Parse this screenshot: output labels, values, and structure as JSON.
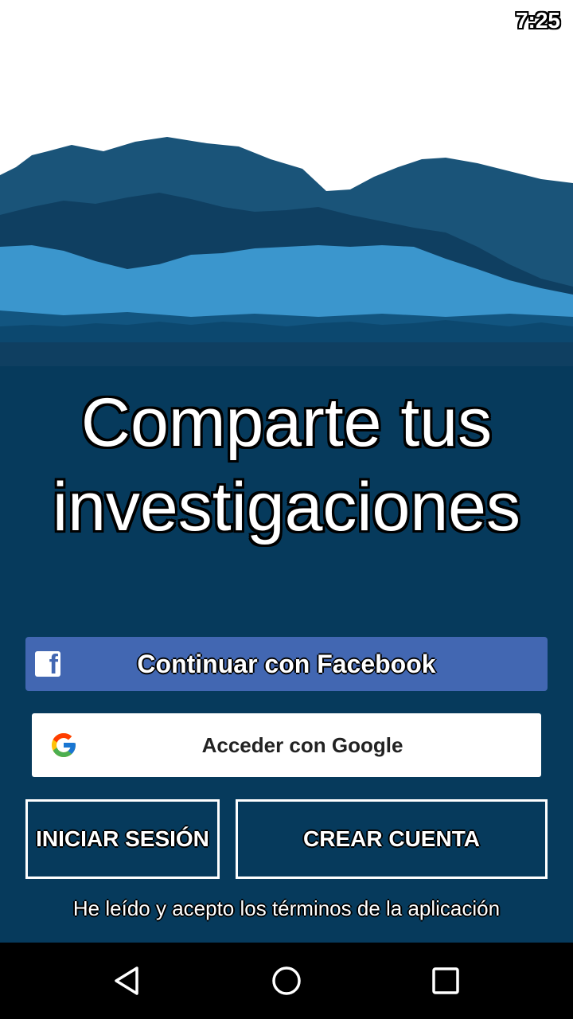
{
  "status_bar": {
    "time": "7:25"
  },
  "hero": {
    "headline_line1": "Comparte tus",
    "headline_line2": "investigaciones",
    "colors": {
      "dark_blue": "#0c3a5e",
      "mid_blue": "#1c5f8a",
      "light_blue": "#3a95cc",
      "navy": "#063a5c"
    }
  },
  "auth": {
    "facebook_label": "Continuar con Facebook",
    "facebook_icon": "facebook-icon",
    "google_label": "Acceder con Google",
    "google_icon": "google-icon",
    "login_label": "INICIAR SESIÓN",
    "signup_label": "CREAR CUENTA",
    "terms_text": "He leído y acepto los términos de la aplicación"
  },
  "nav_bar": {
    "back_icon": "back-triangle-icon",
    "home_icon": "home-circle-icon",
    "recents_icon": "recents-square-icon"
  }
}
